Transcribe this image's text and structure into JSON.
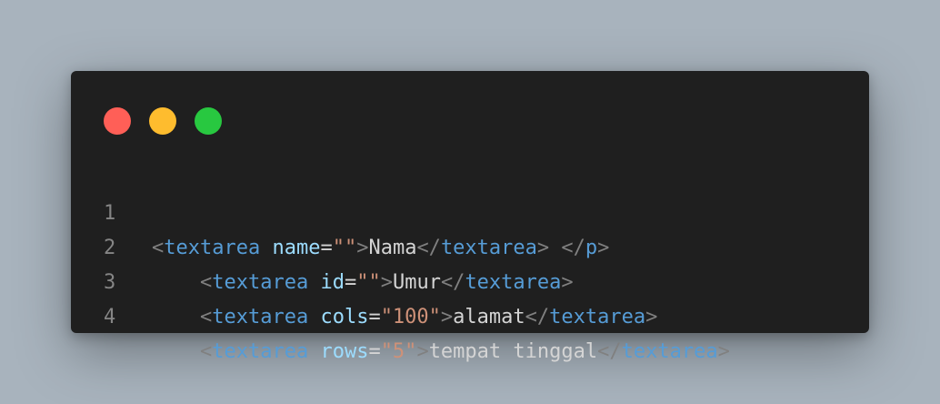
{
  "colors": {
    "background": "#a8b3bd",
    "window": "#1f1f1f",
    "close_dot": "#ff5f57",
    "minimize_dot": "#febc2e",
    "maximize_dot": "#28c840",
    "tag": "#569cd6",
    "attribute": "#9cdcfe",
    "string": "#ce9178",
    "text": "#d4d4d4",
    "punctuation": "#808080",
    "line_number": "#858585"
  },
  "window_controls": [
    "close-dot",
    "minimize-dot",
    "maximize-dot"
  ],
  "code": {
    "lines": [
      {
        "number": "1",
        "indent": "",
        "open_lt": "<",
        "tag": "textarea",
        "space": " ",
        "attr": "name",
        "eq": "=",
        "value": "\"\"",
        "open_gt": ">",
        "content": "Nama",
        "close_lt": "</",
        "close_tag": "textarea",
        "close_gt": ">",
        "trail_space": " ",
        "trail_lt": "</",
        "trail_tag": "p",
        "trail_gt": ">"
      },
      {
        "number": "2",
        "indent": "    ",
        "open_lt": "<",
        "tag": "textarea",
        "space": " ",
        "attr": "id",
        "eq": "=",
        "value": "\"\"",
        "open_gt": ">",
        "content": "Umur",
        "close_lt": "</",
        "close_tag": "textarea",
        "close_gt": ">"
      },
      {
        "number": "3",
        "indent": "    ",
        "open_lt": "<",
        "tag": "textarea",
        "space": " ",
        "attr": "cols",
        "eq": "=",
        "value": "\"100\"",
        "open_gt": ">",
        "content": "alamat",
        "close_lt": "</",
        "close_tag": "textarea",
        "close_gt": ">"
      },
      {
        "number": "4",
        "indent": "    ",
        "open_lt": "<",
        "tag": "textarea",
        "space": " ",
        "attr": "rows",
        "eq": "=",
        "value": "\"5\"",
        "open_gt": ">",
        "content": "tempat tinggal",
        "close_lt": "</",
        "close_tag": "textarea",
        "close_gt": ">"
      }
    ]
  }
}
